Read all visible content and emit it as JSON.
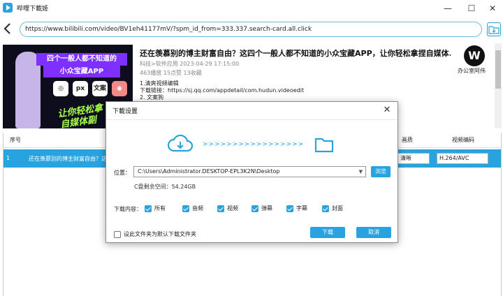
{
  "app": {
    "title": "哔哩下載姬"
  },
  "window": {
    "minimize": "—",
    "maximize": "☐",
    "close": "✕"
  },
  "urlbar": {
    "url": "https://www.bilibili.com/video/BV1eh41177mV/?spm_id_from=333.337.search-card.all.click"
  },
  "video": {
    "title": "还在羡慕别的博主财富自由？这四个一般人都不知道的小众宝藏APP，让你轻松拿捏自媒体...",
    "category_date": "科技>软件应用  2023-04-29 17:15:00",
    "stats": "463播放  15点赞  13收藏",
    "description": [
      "1.清爽视频编辑",
      "下载链接：https://sj.qq.com/appdetail/com.hudun.videoedit",
      "2. 文案狗"
    ],
    "thumbnail": {
      "line1": "四个一般人都不知道的",
      "line2": "小众宝藏APP",
      "icon_labels": [
        "◎",
        "px",
        "文案",
        "◉"
      ],
      "slogan1": "让你轻松拿",
      "slogan2": "自媒体副"
    },
    "uploader_logo": "W",
    "uploader_name": "办公室阿伟"
  },
  "list": {
    "headers": {
      "index": "序号",
      "quality": "画质",
      "codec": "视频编码"
    },
    "rows": [
      {
        "index": "1",
        "title": "还在羡慕别的博主财富自由？这",
        "quality": "清晰",
        "codec": "H.264/AVC"
      }
    ]
  },
  "dialog": {
    "title": "下載设置",
    "close": "✕",
    "arrows": ">>>>>>>>>>>>>>>>>",
    "location_label": "位置：",
    "path": "C:\\Users\\Administrator.DESKTOP-EPL3K2N\\Desktop",
    "browse_label": "浏览",
    "free_space": "C盘剩余空间：54.24GB",
    "content_label": "下载内容：",
    "options": [
      {
        "label": "所有",
        "checked": true
      },
      {
        "label": "音频",
        "checked": true
      },
      {
        "label": "视频",
        "checked": true
      },
      {
        "label": "弹幕",
        "checked": true
      },
      {
        "label": "字幕",
        "checked": true
      },
      {
        "label": "封面",
        "checked": true
      }
    ],
    "default_folder_label": "设此文件夹为默认下载文件夹",
    "download_label": "下载",
    "cancel_label": "取消"
  },
  "colors": {
    "accent": "#29a3e0",
    "row_selected": "#29a3e0"
  },
  "icons": [
    "app-icon",
    "back-arrow-icon",
    "download-folder-icon",
    "cloud-download-icon",
    "folder-icon",
    "chevron-down-icon",
    "close-icon"
  ]
}
